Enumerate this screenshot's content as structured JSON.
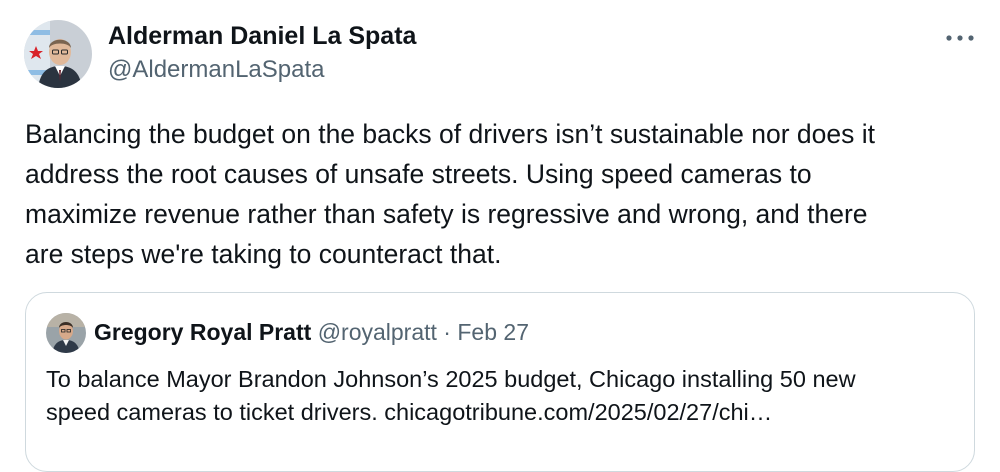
{
  "author": {
    "display_name": "Alderman Daniel La Spata",
    "handle": "@AldermanLaSpata",
    "avatar_icon": "profile-photo-icon"
  },
  "menu": {
    "more_icon": "more-options-icon"
  },
  "tweet": {
    "text": "Balancing the budget on the backs of drivers isn’t sustainable nor does it\naddress the root causes of unsafe streets. Using speed cameras to\nmaximize revenue rather than safety is regressive and wrong, and there\nare steps we're taking to counteract that."
  },
  "quote": {
    "display_name": "Gregory Royal Pratt",
    "handle": "@royalpratt",
    "separator": " · ",
    "date": "Feb 27",
    "text": "To balance Mayor Brandon Johnson’s 2025 budget, Chicago installing 50 new\nspeed cameras to ticket drivers. chicagotribune.com/2025/02/27/chi…"
  },
  "colors": {
    "text": "#0f1419",
    "secondary": "#536471",
    "border": "#cfd9de"
  }
}
